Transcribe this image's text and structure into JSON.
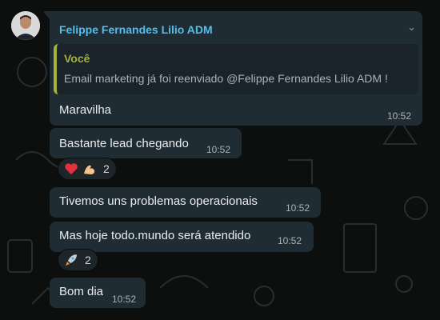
{
  "sender": {
    "name": "Felippe Fernandes Lilio ADM"
  },
  "messages": [
    {
      "quote": {
        "author": "Você",
        "text": "Email marketing já foi reenviado @Felippe Fernandes Lilio ADM !"
      },
      "text": "Maravilha",
      "time": "10:52"
    },
    {
      "text": "Bastante lead chegando",
      "time": "10:52",
      "reaction": {
        "emojis": [
          "heart-emoji",
          "flexed-biceps-emoji"
        ],
        "count": "2"
      }
    },
    {
      "text": "Tivemos uns problemas operacionais",
      "time": "10:52"
    },
    {
      "text": "Mas hoje todo.mundo será atendido",
      "time": "10:52",
      "reaction": {
        "emojis": [
          "rocket-emoji"
        ],
        "count": "2"
      }
    },
    {
      "text": "Bom dia",
      "time": "10:52"
    }
  ],
  "colors": {
    "sender_name": "#53bdeb",
    "quote_accent": "#a5b337",
    "bubble": "#202c33",
    "background": "#0b0c0c"
  }
}
